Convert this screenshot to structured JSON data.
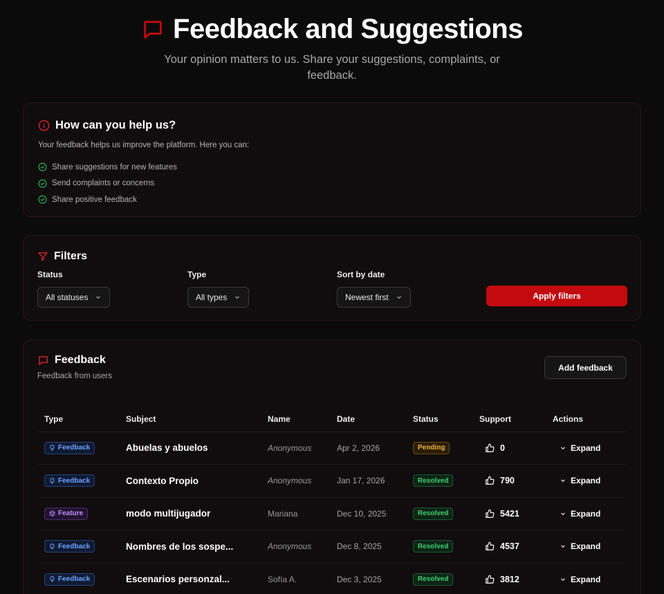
{
  "header": {
    "title": "Feedback and Suggestions",
    "subtitle": "Your opinion matters to us. Share your suggestions, complaints, or feedback."
  },
  "help": {
    "title": "How can you help us?",
    "description": "Your feedback helps us improve the platform. Here you can:",
    "items": [
      "Share suggestions for new features",
      "Send complaints or concerns",
      "Share positive feedback"
    ]
  },
  "filters": {
    "title": "Filters",
    "status": {
      "label": "Status",
      "value": "All statuses"
    },
    "type": {
      "label": "Type",
      "value": "All types"
    },
    "sort": {
      "label": "Sort by date",
      "value": "Newest first"
    },
    "apply_label": "Apply filters"
  },
  "feedback": {
    "title": "Feedback",
    "subtitle": "Feedback from users",
    "add_label": "Add feedback",
    "columns": [
      "Type",
      "Subject",
      "Name",
      "Date",
      "Status",
      "Support",
      "Actions"
    ],
    "expand_label": "Expand",
    "rows": [
      {
        "type": "Feedback",
        "subject": "Abuelas y abuelos",
        "name": "Anonymous",
        "date": "Apr 2, 2026",
        "status": "Pending",
        "support": "0"
      },
      {
        "type": "Feedback",
        "subject": "Contexto Propio",
        "name": "Anonymous",
        "date": "Jan 17, 2026",
        "status": "Resolved",
        "support": "790"
      },
      {
        "type": "Feature",
        "subject": "modo multijugador",
        "name": "Mariana",
        "date": "Dec 10, 2025",
        "status": "Resolved",
        "support": "5421"
      },
      {
        "type": "Feedback",
        "subject": "Nombres de los sospe...",
        "name": "Anonymous",
        "date": "Dec 8, 2025",
        "status": "Resolved",
        "support": "4537"
      },
      {
        "type": "Feedback",
        "subject": "Escenarios personzal...",
        "name": "Sofía A.",
        "date": "Dec 3, 2025",
        "status": "Resolved",
        "support": "3812"
      }
    ]
  },
  "colors": {
    "accent": "#c30a0e",
    "background": "#0b0b0b",
    "card": "#110c0d"
  }
}
